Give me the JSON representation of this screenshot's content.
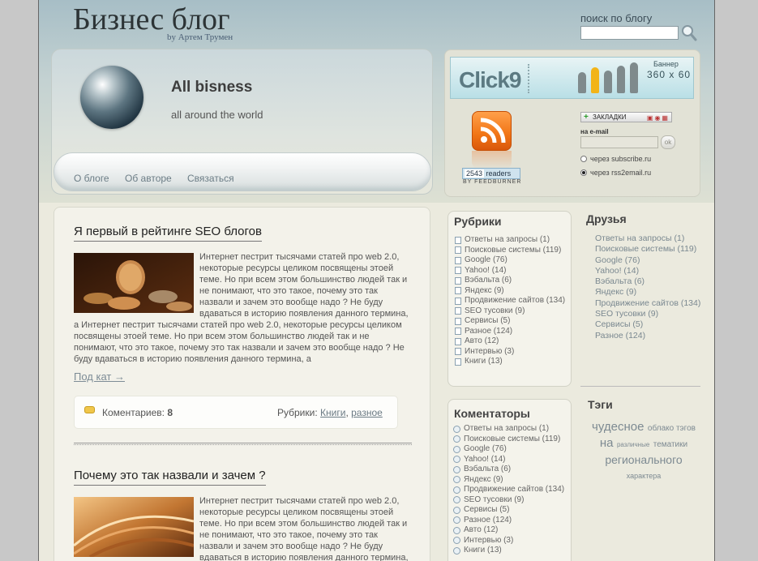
{
  "site": {
    "title": "Бизнес блог",
    "byline": "by Артем Трумен",
    "search_label": "поиск по блогу",
    "search_value": ""
  },
  "hero": {
    "title": "All bisness",
    "subtitle": "all around the world"
  },
  "nav": [
    "О блоге",
    "Об авторе",
    "Связаться"
  ],
  "widget": {
    "banner_logo": "Click9",
    "banner_caption": "Баннер",
    "banner_size": "360 x 60",
    "readers_count": "2543",
    "readers_label": "readers",
    "feedburner": "BY FEEDBURNER",
    "bookmarks_label": "ЗАКЛАДКИ",
    "email_label": "на e-mail",
    "ok_label": "ok",
    "options": [
      {
        "label": "через subscribe.ru",
        "checked": false
      },
      {
        "label": "через rss2email.ru",
        "checked": true
      }
    ]
  },
  "posts": [
    {
      "title": "Я первый в рейтинге SEO блогов",
      "body": "Интернет пестрит тысячами статей про web 2.0, некоторые ресурсы целиком посвящены этоей теме. Но при всем этом большинство людей так и не понимают, что это такое, почему это так назвали и зачем это вообще надо ? Не буду вдаваться в историю появления данного термина, а Интернет пестрит тысячами статей про web 2.0, некоторые ресурсы целиком посвящены этоей теме. Но при всем этом большинство людей так и не понимают, что это такое, почему это так назвали и зачем это вообще надо ? Не буду вдаваться в историю появления данного термина, а",
      "more": "Под кат →",
      "comments_label": "Коментариев:",
      "comments_count": "8",
      "rubrics_label": "Рубрики:",
      "rubrics": [
        "Книги",
        "разное"
      ]
    },
    {
      "title": "Почему это так назвали и зачем ?",
      "body": "Интернет пестрит тысячами статей про web 2.0, некоторые ресурсы целиком посвящены этоей теме. Но при всем этом большинство людей так и не понимают, что это такое, почему это так назвали и зачем это вообще надо ? Не буду вдаваться в историю появления данного термина, а Интернет"
    }
  ],
  "rubrics_box": {
    "title": "Рубрики",
    "items": [
      "Ответы на запросы (1)",
      "Поисковые системы (119)",
      "Google (76)",
      "Yahoo! (14)",
      "Вэбальта (6)",
      "Яндекс (9)",
      "Продвижение сайтов (134)",
      "SEO тусовки (9)",
      "Сервисы (5)",
      "Разное (124)",
      "Авто (12)",
      "Интервью (3)",
      "Книги (13)"
    ]
  },
  "commentators_box": {
    "title": "Коментаторы",
    "items": [
      "Ответы на запросы (1)",
      "Поисковые системы (119)",
      "Google (76)",
      "Yahoo! (14)",
      "Вэбальта (6)",
      "Яндекс (9)",
      "Продвижение сайтов (134)",
      "SEO тусовки (9)",
      "Сервисы (5)",
      "Разное (124)",
      "Авто (12)",
      "Интервью (3)",
      "Книги (13)"
    ]
  },
  "friends": {
    "title": "Друзья",
    "items": [
      "Ответы на запросы (1)",
      "Поисковые системы (119)",
      "Google (76)",
      "Yahoo! (14)",
      "Вэбальта (6)",
      "Яндекс (9)",
      "Продвижение сайтов (134)",
      "SEO тусовки (9)",
      "Сервисы (5)",
      "Разное (124)"
    ]
  },
  "tags": {
    "title": "Тэги",
    "items": [
      {
        "text": "чудесное",
        "size": 15
      },
      {
        "text": "облако тэгов",
        "size": 10
      },
      {
        "text": "на",
        "size": 15
      },
      {
        "text": "различные",
        "size": 8
      },
      {
        "text": "тематики",
        "size": 10
      },
      {
        "text": "регионального",
        "size": 14
      },
      {
        "text": "характера",
        "size": 9
      }
    ]
  }
}
